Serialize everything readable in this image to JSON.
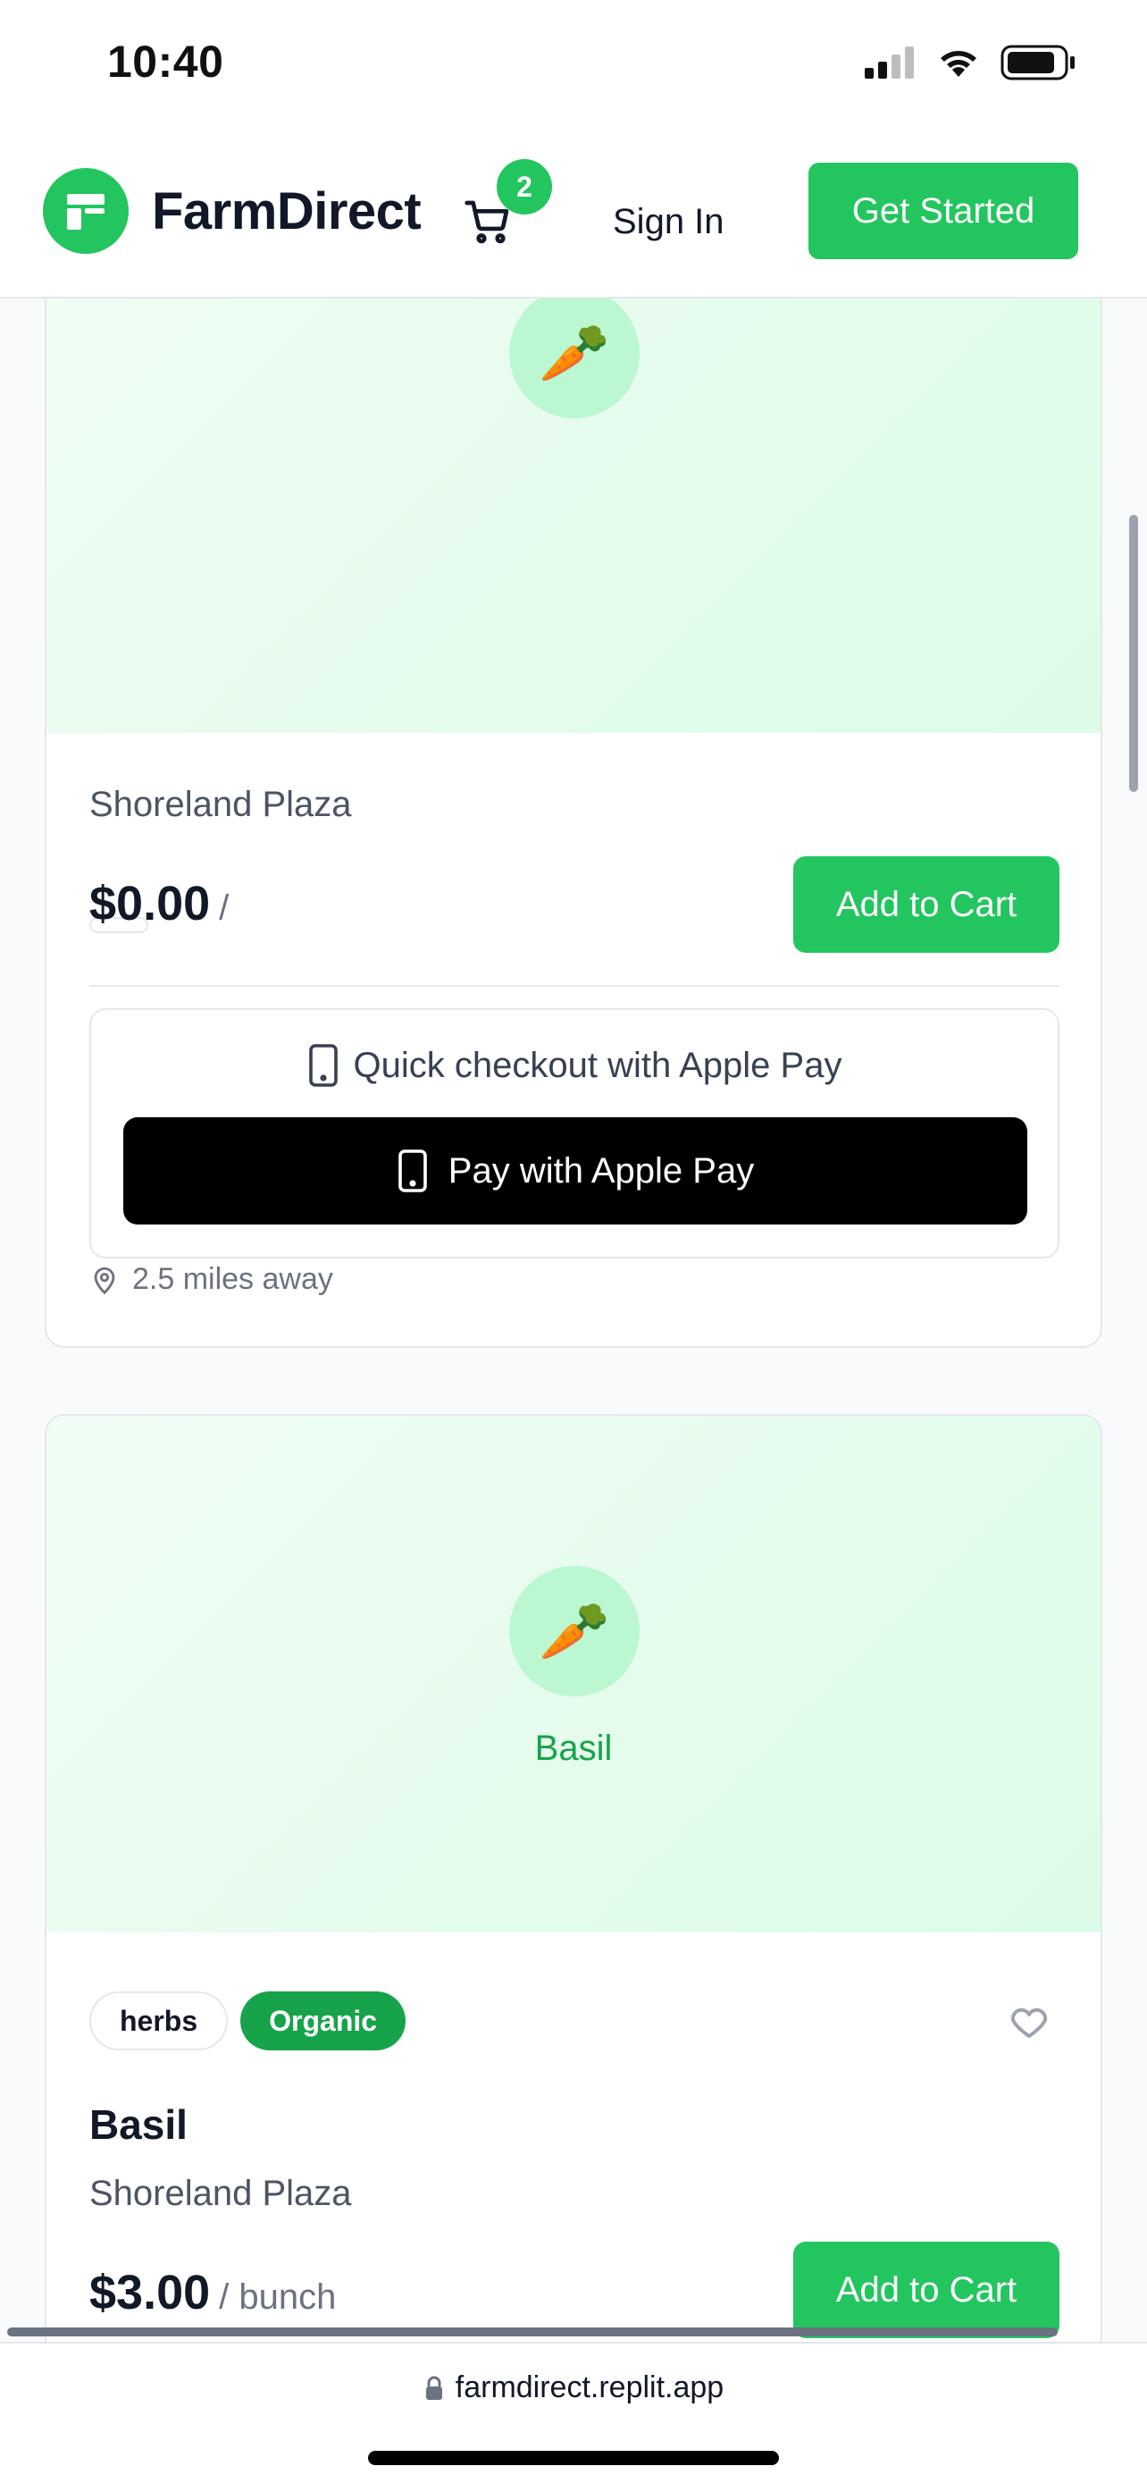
{
  "status_bar": {
    "time": "10:40"
  },
  "header": {
    "brand": "FarmDirect",
    "cart_count": "2",
    "sign_in": "Sign In",
    "get_started": "Get Started"
  },
  "products": [
    {
      "overlay_name": "",
      "emoji": "🥕",
      "tags": [],
      "name": "",
      "vendor": "Shoreland Plaza",
      "price": "$0.00",
      "unit": "/",
      "add_to_cart": "Add to Cart",
      "quick_checkout": "Quick checkout with Apple Pay",
      "apple_pay_button": "Pay with Apple Pay",
      "distance": "2.5 miles away"
    },
    {
      "overlay_name": "Basil",
      "emoji": "🥕",
      "tags": [
        "herbs",
        "Organic"
      ],
      "name": "Basil",
      "vendor": "Shoreland Plaza",
      "price": "$3.00",
      "unit": "/ bunch",
      "add_to_cart": "Add to Cart"
    }
  ],
  "browser": {
    "url": "farmdirect.replit.app"
  },
  "colors": {
    "primary": "#22c55e",
    "primary_dark": "#16a34a",
    "image_bg": "#dcfce7",
    "emoji_circle": "#bbf7d0",
    "text": "#111827",
    "muted": "#6b7280"
  },
  "icons": [
    "signal-icon",
    "wifi-icon",
    "battery-icon",
    "storefront-icon",
    "cart-icon",
    "carrot-icon",
    "heart-icon",
    "phone-icon",
    "map-pin-icon",
    "lock-icon"
  ]
}
